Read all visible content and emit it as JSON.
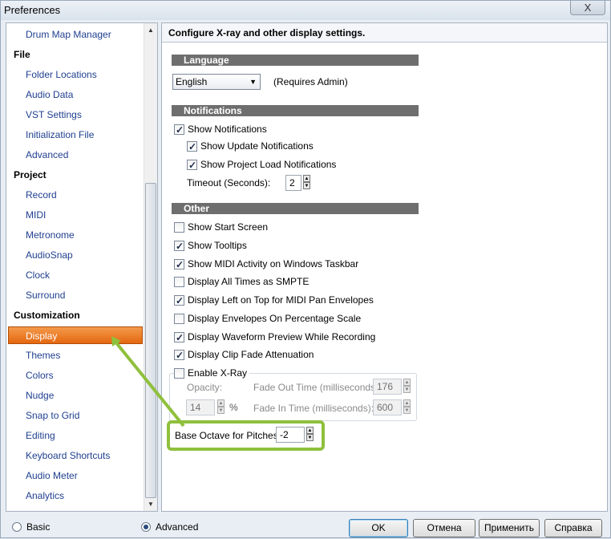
{
  "window": {
    "title": "Preferences",
    "close": "X"
  },
  "sidebar": {
    "items": [
      {
        "label": "Drum Map Manager",
        "type": "child"
      },
      {
        "label": "File",
        "type": "group"
      },
      {
        "label": "Folder Locations",
        "type": "child"
      },
      {
        "label": "Audio Data",
        "type": "child"
      },
      {
        "label": "VST Settings",
        "type": "child"
      },
      {
        "label": "Initialization File",
        "type": "child"
      },
      {
        "label": "Advanced",
        "type": "child"
      },
      {
        "label": "Project",
        "type": "group"
      },
      {
        "label": "Record",
        "type": "child"
      },
      {
        "label": "MIDI",
        "type": "child"
      },
      {
        "label": "Metronome",
        "type": "child"
      },
      {
        "label": "AudioSnap",
        "type": "child"
      },
      {
        "label": "Clock",
        "type": "child"
      },
      {
        "label": "Surround",
        "type": "child"
      },
      {
        "label": "Customization",
        "type": "group"
      },
      {
        "label": "Display",
        "type": "child",
        "selected": true
      },
      {
        "label": "Themes",
        "type": "child"
      },
      {
        "label": "Colors",
        "type": "child"
      },
      {
        "label": "Nudge",
        "type": "child"
      },
      {
        "label": "Snap to Grid",
        "type": "child"
      },
      {
        "label": "Editing",
        "type": "child"
      },
      {
        "label": "Keyboard Shortcuts",
        "type": "child"
      },
      {
        "label": "Audio Meter",
        "type": "child"
      },
      {
        "label": "Analytics",
        "type": "child"
      }
    ]
  },
  "panel": {
    "header": "Configure X-ray and other display settings.",
    "language": {
      "section": "Language",
      "selected": "English",
      "note": "(Requires Admin)"
    },
    "notifications": {
      "section": "Notifications",
      "show_notifications": {
        "label": "Show Notifications",
        "checked": true
      },
      "show_update": {
        "label": "Show Update Notifications",
        "checked": true
      },
      "show_project_load": {
        "label": "Show Project Load Notifications",
        "checked": true
      },
      "timeout_label": "Timeout (Seconds):",
      "timeout_value": "2"
    },
    "other": {
      "section": "Other",
      "options": [
        {
          "label": "Show Start Screen",
          "checked": false
        },
        {
          "label": "Show Tooltips",
          "checked": true
        },
        {
          "label": "Show MIDI Activity on Windows Taskbar",
          "checked": true
        },
        {
          "label": "Display All Times as SMPTE",
          "checked": false
        },
        {
          "label": "Display Left on Top for MIDI Pan Envelopes",
          "checked": true
        },
        {
          "label": "Display Envelopes On Percentage Scale",
          "checked": false
        },
        {
          "label": "Display Waveform Preview While Recording",
          "checked": true
        },
        {
          "label": "Display Clip Fade Attenuation",
          "checked": true
        }
      ]
    },
    "xray": {
      "enable": {
        "label": "Enable X-Ray",
        "checked": false
      },
      "opacity_label": "Opacity:",
      "opacity_value": "14",
      "opacity_unit": "%",
      "fade_out_label": "Fade Out Time (milliseconds):",
      "fade_out_value": "176",
      "fade_in_label": "Fade In Time (milliseconds):",
      "fade_in_value": "600"
    },
    "base_octave": {
      "label": "Base Octave for Pitches:",
      "value": "-2"
    }
  },
  "footer": {
    "mode_basic": "Basic",
    "mode_advanced": "Advanced",
    "mode_selected": "Advanced",
    "ok": "OK",
    "cancel": "Отмена",
    "apply": "Применить",
    "help": "Справка"
  },
  "colors": {
    "selection": "#e5670f",
    "highlight": "#8fc03d",
    "section_bar": "#6e6e6e",
    "link": "#1f3f8f"
  }
}
